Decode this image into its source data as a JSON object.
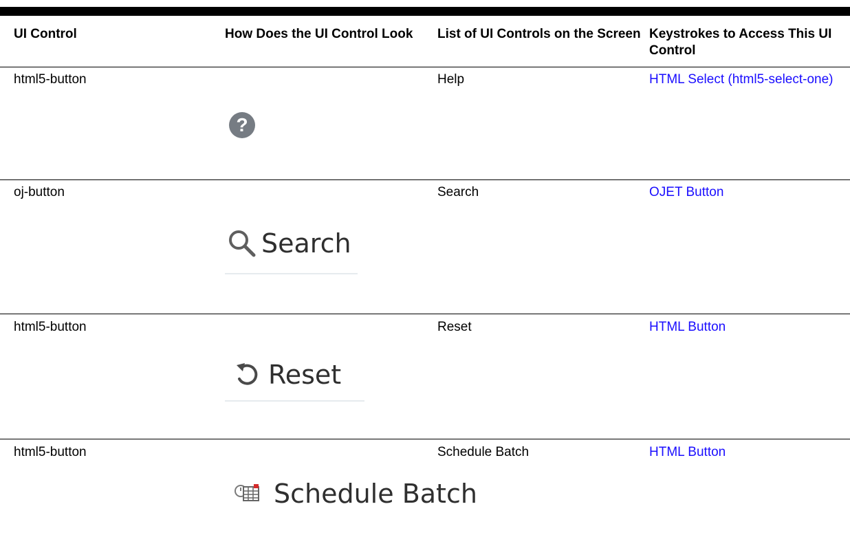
{
  "table": {
    "headers": {
      "col1": "UI Control",
      "col2": "How Does the UI Control Look",
      "col3": "List of UI Controls on the Screen",
      "col4": "Keystrokes to Access This UI Control"
    },
    "rows": [
      {
        "control": "html5-button",
        "look_icon": "help-icon",
        "screen": "Help",
        "keystrokes": "HTML Select (html5-select-one)"
      },
      {
        "control": "oj-button",
        "look_icon": "search-icon",
        "look_label": "Search",
        "screen": "Search",
        "keystrokes": "OJET Button"
      },
      {
        "control": "html5-button",
        "look_icon": "reset-icon",
        "look_label": "Reset",
        "screen": "Reset",
        "keystrokes": "HTML Button"
      },
      {
        "control": "html5-button",
        "look_icon": "schedule-batch-icon",
        "look_label": "Schedule Batch",
        "screen": "Schedule Batch",
        "keystrokes": "HTML Button"
      }
    ]
  },
  "colors": {
    "link": "#1a0dff",
    "help_button": "#767c83"
  }
}
